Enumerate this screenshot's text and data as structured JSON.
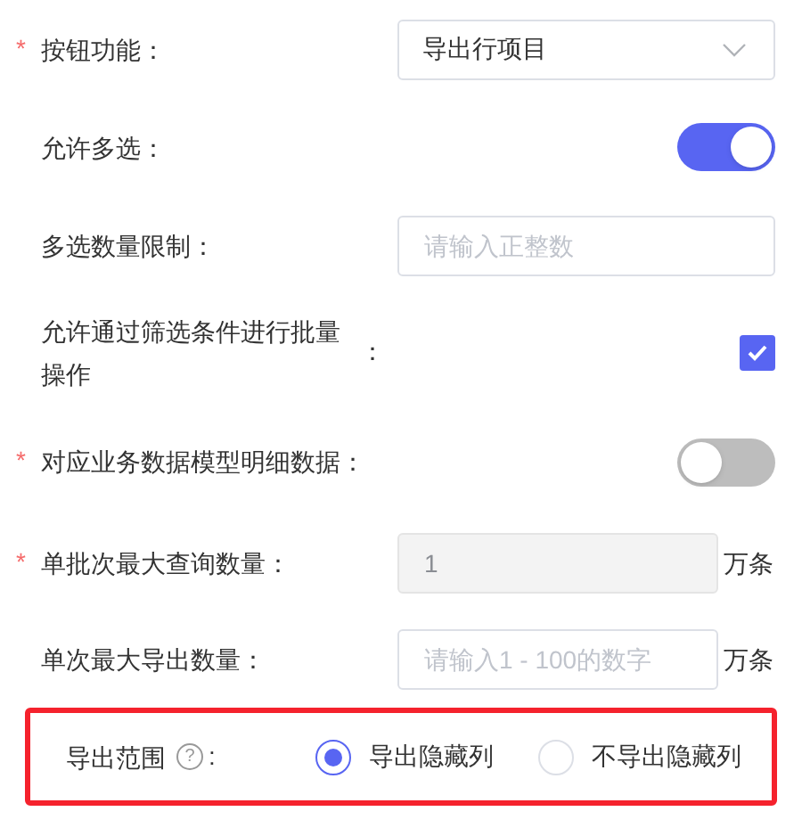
{
  "rows": [
    {
      "kind": "select",
      "required_mark": "*",
      "label": "按钮功能：",
      "value": "导出行项目"
    },
    {
      "kind": "switch",
      "label": "允许多选：",
      "on": true
    },
    {
      "kind": "input",
      "label": "多选数量限制：",
      "placeholder": "请输入正整数"
    },
    {
      "kind": "checkbox",
      "label": "允许通过筛选条件进行批量操作",
      "colon": "：",
      "checked": true
    },
    {
      "kind": "switch",
      "required_mark": "*",
      "label": "对应业务数据模型明细数据：",
      "on": false
    },
    {
      "kind": "input",
      "required_mark": "*",
      "label": "单批次最大查询数量：",
      "value": "1",
      "disabled": true,
      "unit": "万条"
    },
    {
      "kind": "input",
      "label": "单次最大导出数量：",
      "placeholder": "请输入1 - 100的数字",
      "disabled": false,
      "unit": "万条"
    },
    {
      "kind": "radio",
      "highlighted": true,
      "label": "导出范围",
      "help": "?",
      "colon": ":",
      "options": [
        {
          "label": "导出隐藏列",
          "selected": true
        },
        {
          "label": "不导出隐藏列",
          "selected": false
        }
      ]
    }
  ]
}
